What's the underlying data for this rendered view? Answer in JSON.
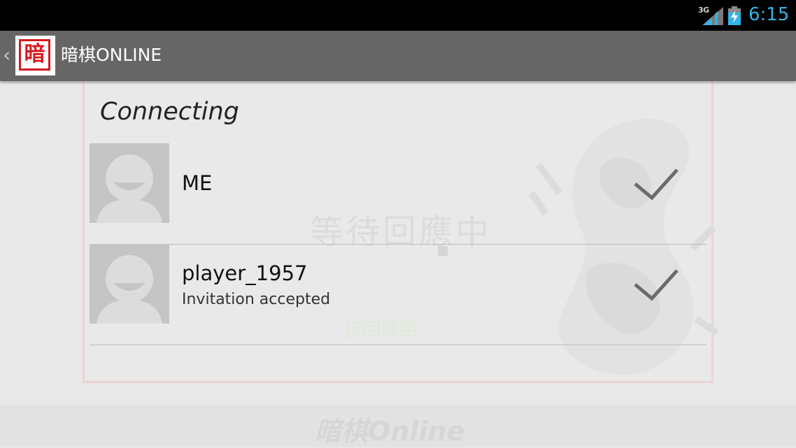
{
  "status_bar": {
    "network": "3G",
    "time": "6:15",
    "icons": [
      "signal-icon",
      "battery-charging-icon"
    ]
  },
  "action_bar": {
    "logo_char": "暗",
    "title": "暗棋ONLINE",
    "up_icon": "chevron-left-icon"
  },
  "background": {
    "wait_text": "等待回應中",
    "green_text": "按回返回",
    "brand": "暗棋Online"
  },
  "dialog": {
    "title": "Connecting",
    "players": [
      {
        "name": "ME",
        "status": "",
        "ready": true
      },
      {
        "name": "player_1957",
        "status": "Invitation accepted",
        "ready": true
      }
    ]
  },
  "colors": {
    "action_bar": "#666666",
    "clock": "#33b5e5",
    "logo_red": "#d5191f",
    "check": "#6b6b6b"
  }
}
